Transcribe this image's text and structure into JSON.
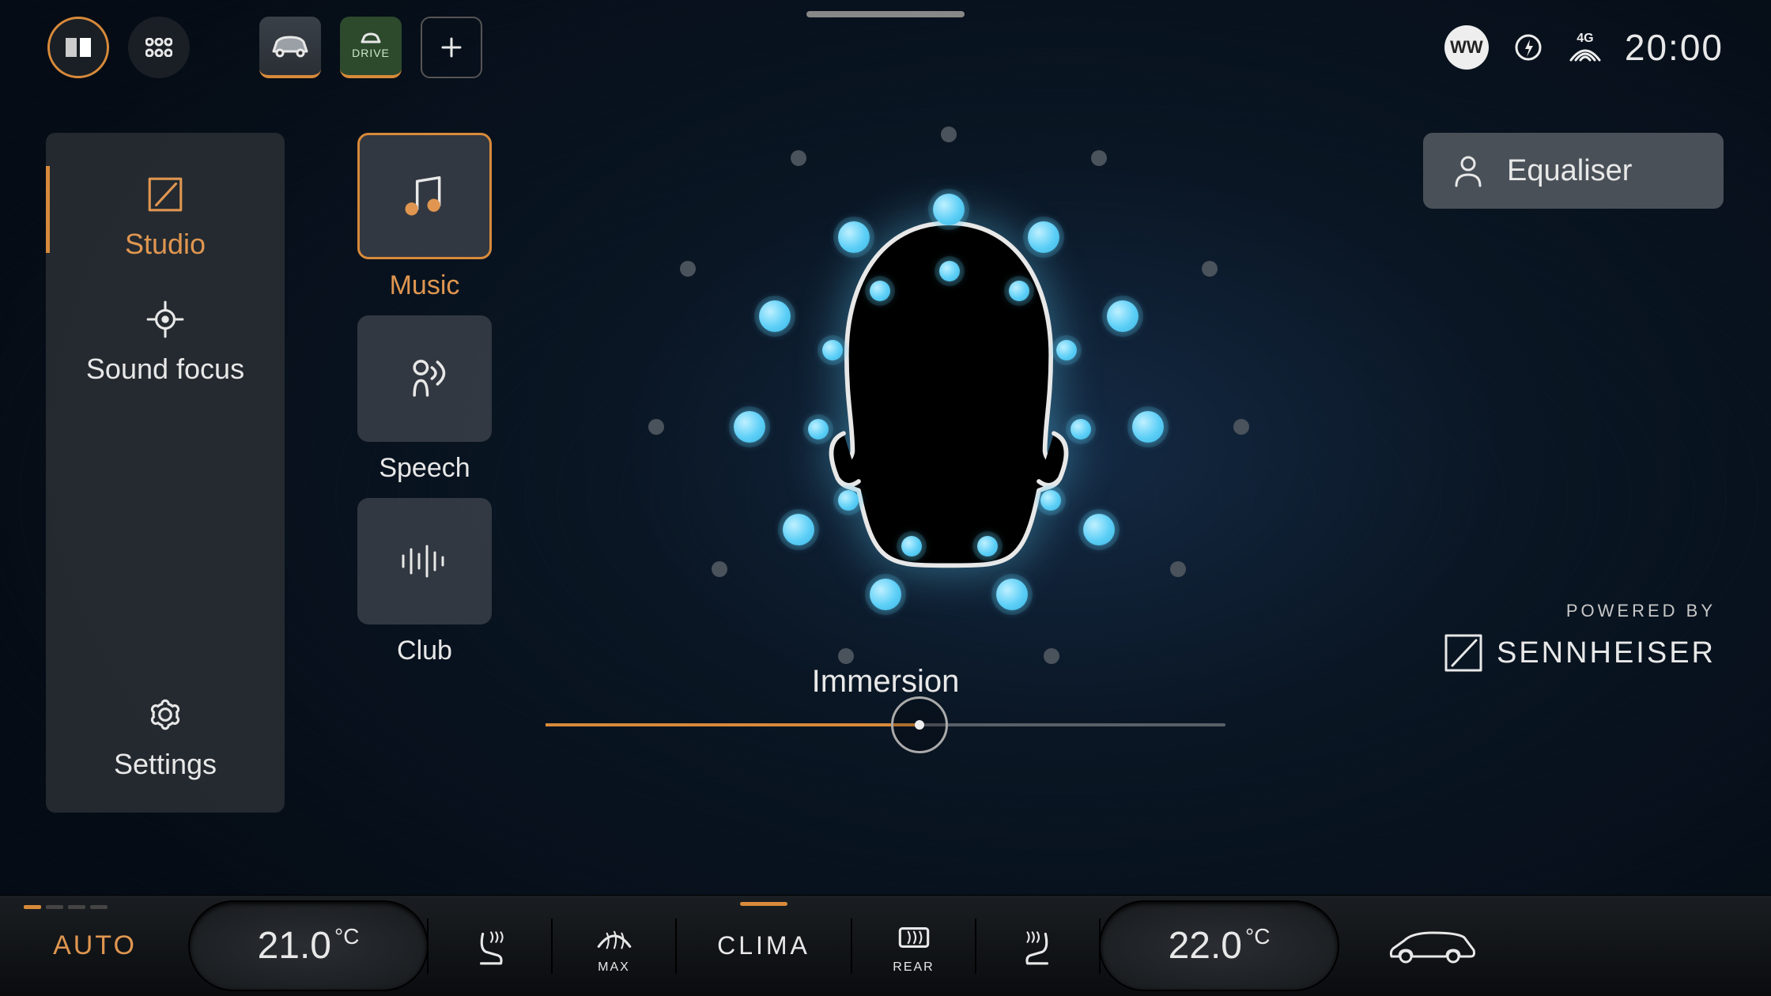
{
  "topbar": {
    "drive_label": "DRIVE",
    "signal_label": "4G",
    "badge": "WW",
    "clock": "20:00"
  },
  "sidebar": {
    "items": [
      {
        "id": "studio",
        "label": "Studio",
        "active": true
      },
      {
        "id": "sound-focus",
        "label": "Sound focus",
        "active": false
      },
      {
        "id": "settings",
        "label": "Settings",
        "active": false
      }
    ]
  },
  "presets": [
    {
      "id": "music",
      "label": "Music",
      "active": true
    },
    {
      "id": "speech",
      "label": "Speech",
      "active": false
    },
    {
      "id": "club",
      "label": "Club",
      "active": false
    }
  ],
  "immersion": {
    "label": "Immersion",
    "value_percent": 55
  },
  "equaliser": {
    "label": "Equaliser"
  },
  "brand": {
    "sub": "POWERED BY",
    "name": "SENNHEISER"
  },
  "climate": {
    "auto_label": "AUTO",
    "left_temp_value": "21.0",
    "left_temp_unit": "°C",
    "right_temp_value": "22.0",
    "right_temp_unit": "°C",
    "clima_label": "CLIMA",
    "max_label": "MAX",
    "rear_label": "REAR"
  }
}
